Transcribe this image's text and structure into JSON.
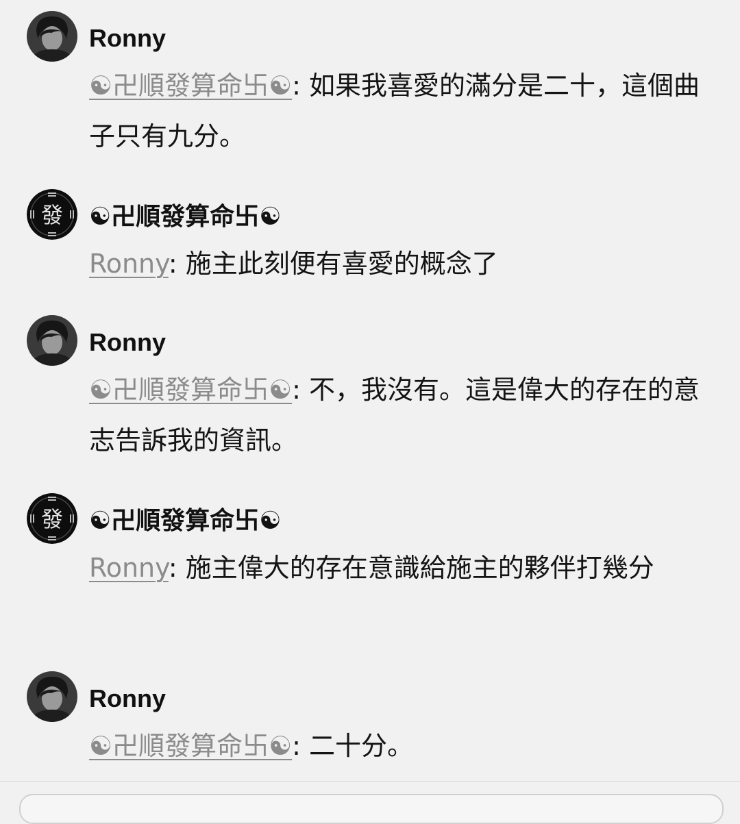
{
  "messages": [
    {
      "author": "Ronny",
      "avatar": "ronny-avatar",
      "mention": "☯卍順發算命卐☯",
      "sep": ": ",
      "text": "如果我喜愛的滿分是二十，這個曲子只有九分。"
    },
    {
      "author": "☯卍順發算命卐☯",
      "avatar": "fa-avatar",
      "mention": "Ronny",
      "sep": ": ",
      "text": "施主此刻便有喜愛的概念了"
    },
    {
      "author": "Ronny",
      "avatar": "ronny-avatar",
      "mention": "☯卍順發算命卐☯",
      "sep": ": ",
      "text": "不，我沒有。這是偉大的存在的意志告訴我的資訊。"
    },
    {
      "author": "☯卍順發算命卐☯",
      "avatar": "fa-avatar",
      "mention": "Ronny",
      "sep": ": ",
      "text": "施主偉大的存在意識給施主的夥伴打幾分"
    },
    {
      "author": "Ronny",
      "avatar": "ronny-avatar",
      "mention": "☯卍順發算命卐☯",
      "sep": ": ",
      "text": "二十分。"
    }
  ],
  "avatars": {
    "fa_glyph": "發"
  },
  "colors": {
    "background": "#f1f1f1",
    "text": "#141414",
    "mention": "#8b8b8b"
  }
}
